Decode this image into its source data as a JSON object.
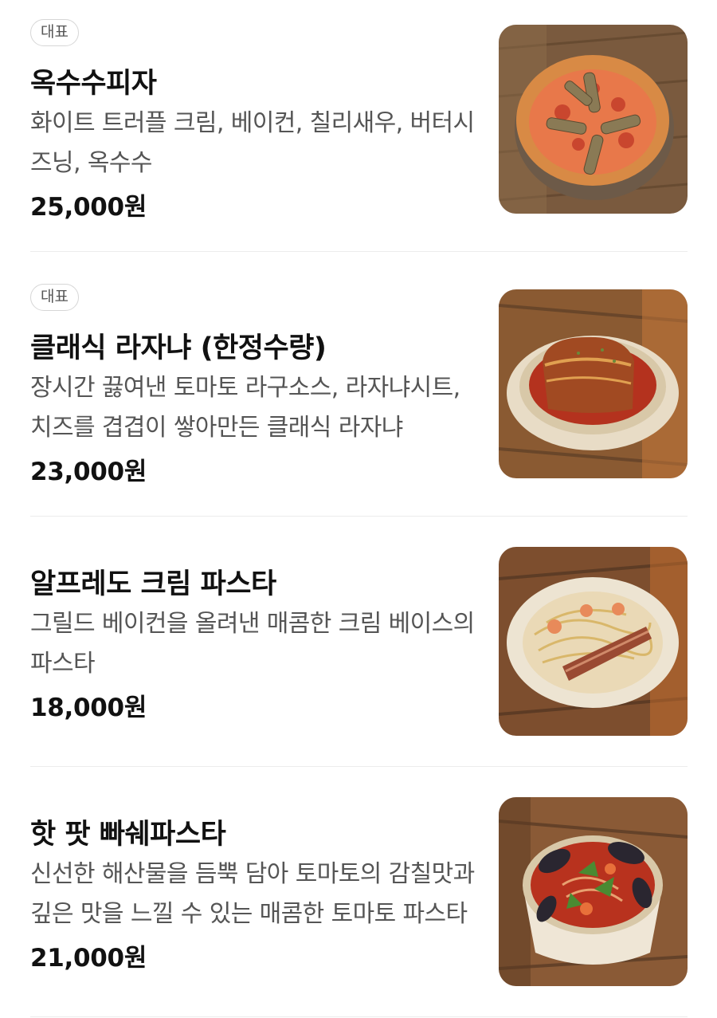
{
  "menu": {
    "items": [
      {
        "badge": "대표",
        "name": "옥수수피자",
        "description": "화이트 트러플 크림, 베이컨, 칠리새우, 버터시즈닝, 옥수수",
        "price": "25,000원",
        "photo": "corn-pizza-photo"
      },
      {
        "badge": "대표",
        "name": "클래식 라자냐 (한정수량)",
        "description": "장시간 끓여낸 토마토 라구소스, 라자냐시트, 치즈를 겹겹이 쌓아만든 클래식 라자냐",
        "price": "23,000원",
        "photo": "lasagna-photo"
      },
      {
        "name": "알프레도 크림 파스타",
        "description": "그릴드 베이컨을 올려낸 매콤한 크림 베이스의 파스타",
        "price": "18,000원",
        "photo": "alfredo-pasta-photo"
      },
      {
        "name": "핫 팟 빠쉐파스타",
        "description": "신선한 해산물을 듬뿍 담아 토마토의 감칠맛과 깊은 맛을 느낄 수 있는 매콤한 토마토 파스타",
        "price": "21,000원",
        "photo": "seafood-pasta-photo"
      }
    ]
  },
  "colors": {
    "text_primary": "#111111",
    "text_secondary": "#555555",
    "badge_border": "#d6d6d6",
    "divider": "#ececec"
  }
}
